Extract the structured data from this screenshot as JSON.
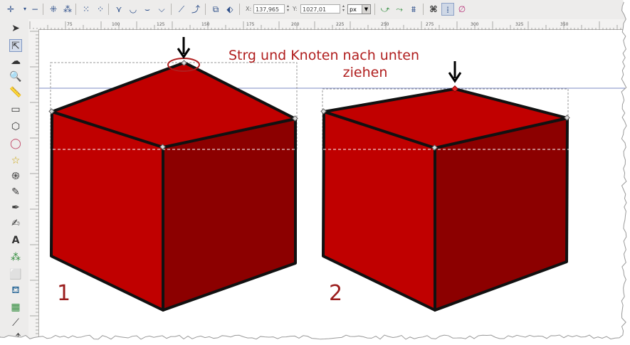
{
  "toolbar": {
    "x_label": "X:",
    "x_value": "137,965",
    "y_label": "Y:",
    "y_value": "1027,01",
    "unit": "px"
  },
  "canvas": {
    "annotation_line1": "Strg und Knoten nach unten",
    "annotation_line2": "ziehen",
    "cube1_number": "1",
    "cube2_number": "2"
  },
  "ruler_labels": [
    "75",
    "100",
    "125",
    "150",
    "175",
    "200",
    "225",
    "250",
    "275",
    "300",
    "325",
    "350"
  ],
  "colors": {
    "cube_top": "#c10000",
    "cube_left": "#c00000",
    "cube_right": "#8c0000",
    "outline": "#111111",
    "annotation": "#b01e1e",
    "selected_node": "#e52525"
  },
  "icons": {
    "toolbar": [
      "add-node-icon",
      "delete-node-icon",
      "join-nodes-icon",
      "break-path-icon",
      "cusp-node-icon",
      "smooth-node-icon",
      "line-segment-icon",
      "curve-segment-icon",
      "object-to-path-icon",
      "stroke-to-path-icon"
    ],
    "toolbox": [
      "selector-icon",
      "node-tool-icon",
      "tweak-icon",
      "zoom-icon",
      "measure-icon",
      "rectangle-icon",
      "3d-box-icon",
      "ellipse-icon",
      "star-icon",
      "spiral-icon",
      "pencil-icon",
      "pen-icon",
      "calligraphy-icon",
      "text-icon",
      "spray-icon",
      "eraser-icon",
      "paint-bucket-icon",
      "gradient-icon",
      "dropper-icon",
      "connector-icon"
    ]
  }
}
